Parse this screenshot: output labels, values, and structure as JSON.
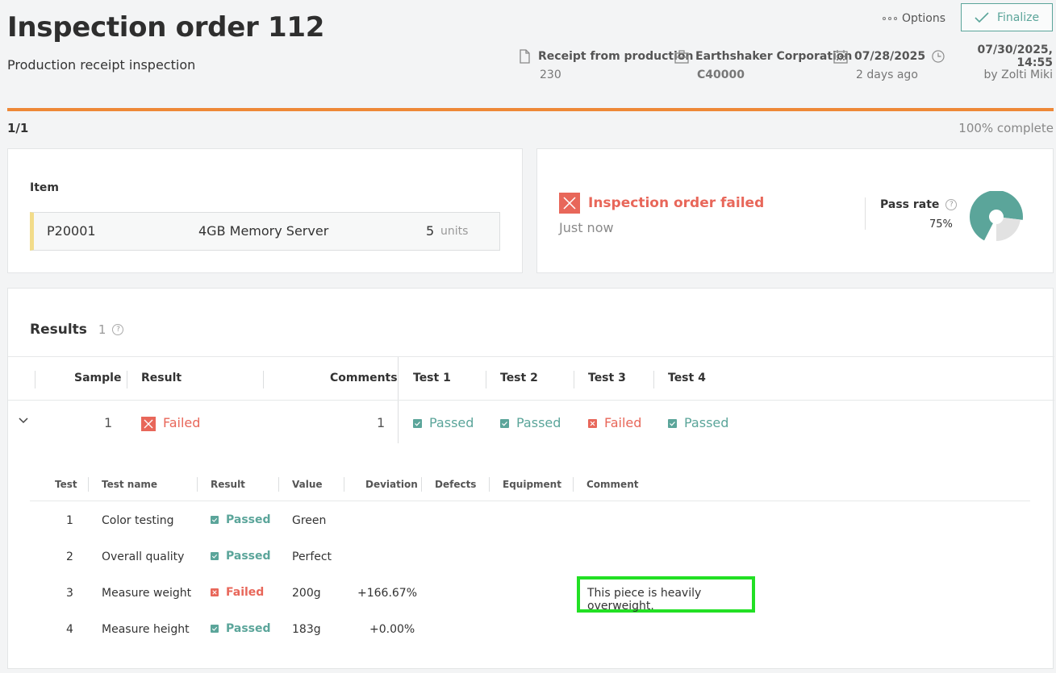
{
  "header": {
    "title": "Inspection order 112",
    "subtitle": "Production receipt inspection",
    "options_label": "Options",
    "finalize_label": "Finalize"
  },
  "meta": {
    "source": {
      "icon": "document-icon",
      "label": "Receipt from production",
      "value": "230"
    },
    "company": {
      "icon": "building-icon",
      "label": "Earthshaker Corporation",
      "value": "C40000"
    },
    "date": {
      "icon": "calendar-icon",
      "label": "07/28/2025",
      "value": "2 days ago"
    },
    "updated": {
      "icon": "clock-icon",
      "label": "07/30/2025, 14:55",
      "value": "by Zolti Miki"
    }
  },
  "progress": {
    "left_label": "1/1",
    "right_label": "100% complete",
    "fraction": 1.0,
    "color": "#ee8837"
  },
  "item": {
    "label": "Item",
    "code": "P20001",
    "name": "4GB Memory Server",
    "quantity": "5",
    "unit": "units"
  },
  "status": {
    "title": "Inspection order failed",
    "time": "Just now",
    "pass_rate_label": "Pass rate",
    "pass_rate_value": "75%",
    "pass_rate_fraction": 0.75,
    "pass_color": "#5ba59a",
    "fail_color": "#e8675a"
  },
  "results": {
    "title": "Results",
    "count": "1",
    "columns": {
      "sample": "Sample",
      "result": "Result",
      "comments": "Comments",
      "test1": "Test 1",
      "test2": "Test 2",
      "test3": "Test 3",
      "test4": "Test 4"
    },
    "row": {
      "sample": "1",
      "result": "Failed",
      "comments": "1",
      "test1": "Passed",
      "test2": "Passed",
      "test3": "Failed",
      "test4": "Passed"
    },
    "detail_columns": {
      "test": "Test",
      "test_name": "Test name",
      "result": "Result",
      "value": "Value",
      "deviation": "Deviation",
      "defects": "Defects",
      "equipment": "Equipment",
      "comment": "Comment"
    },
    "details": [
      {
        "test": "1",
        "name": "Color testing",
        "result": "Passed",
        "value": "Green",
        "deviation": "",
        "comment": ""
      },
      {
        "test": "2",
        "name": "Overall quality",
        "result": "Passed",
        "value": "Perfect",
        "deviation": "",
        "comment": ""
      },
      {
        "test": "3",
        "name": "Measure weight",
        "result": "Failed",
        "value": "200g",
        "deviation": "+166.67%",
        "comment": "This piece is heavily overweight."
      },
      {
        "test": "4",
        "name": "Measure height",
        "result": "Passed",
        "value": "183g",
        "deviation": "+0.00%",
        "comment": ""
      }
    ]
  }
}
